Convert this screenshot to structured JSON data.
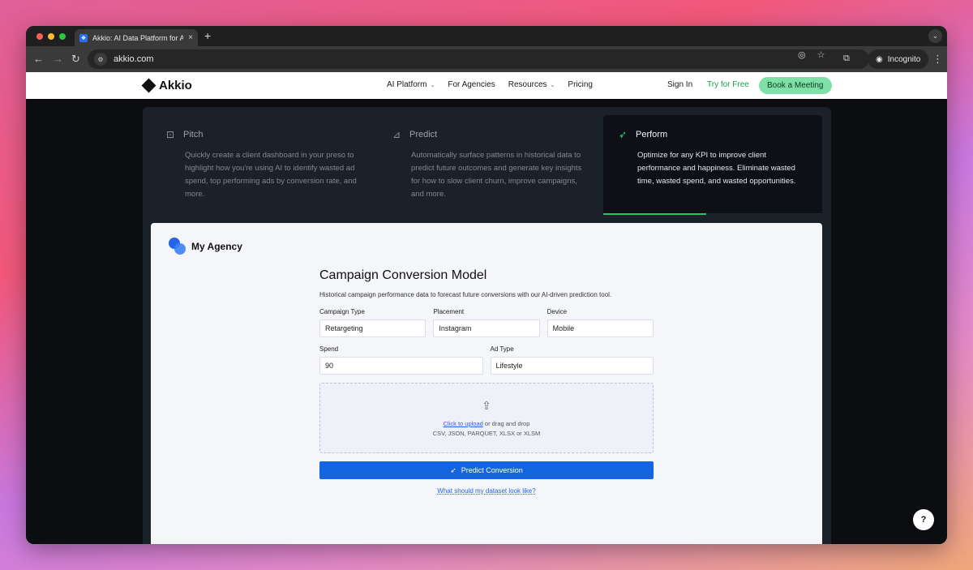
{
  "browser": {
    "tab_title": "Akkio: AI Data Platform for Ag",
    "tab_close": "×",
    "new_tab": "+",
    "url": "akkio.com",
    "incognito_label": "Incognito"
  },
  "nav": {
    "logo_text": "Akkio",
    "links": [
      {
        "label": "AI Platform",
        "has_dropdown": true
      },
      {
        "label": "For Agencies",
        "has_dropdown": false
      },
      {
        "label": "Resources",
        "has_dropdown": true
      },
      {
        "label": "Pricing",
        "has_dropdown": false
      }
    ],
    "sign_in": "Sign In",
    "try_free": "Try for Free",
    "book_meeting": "Book a Meeting"
  },
  "features": [
    {
      "title": "Pitch",
      "icon": "presentation-icon",
      "description": "Quickly create a client dashboard in your preso to highlight how you're using AI to identify wasted ad spend, top performing ads by conversion rate, and more.",
      "active": false
    },
    {
      "title": "Predict",
      "icon": "chart-icon",
      "description": "Automatically surface patterns in historical data to predict future outcomes and generate key insights for how to slow client churn, improve campaigns, and more.",
      "active": false
    },
    {
      "title": "Perform",
      "icon": "rocket-icon",
      "description": "Optimize for any KPI to improve client performance and happiness. Eliminate wasted time, wasted spend, and wasted opportunities.",
      "active": true,
      "progress_fraction": 0.47
    }
  ],
  "card": {
    "brand": "My Agency",
    "title": "Campaign Conversion Model",
    "subtitle": "Historical campaign performance data to forecast future conversions with our AI-driven prediction tool.",
    "fields": {
      "campaign_type": {
        "label": "Campaign Type",
        "value": "Retargeting"
      },
      "placement": {
        "label": "Placement",
        "value": "Instagram"
      },
      "device": {
        "label": "Device",
        "value": "Mobile"
      },
      "spend": {
        "label": "Spend",
        "value": "90"
      },
      "ad_type": {
        "label": "Ad Type",
        "value": "Lifestyle"
      }
    },
    "upload": {
      "link": "Click to upload",
      "rest": " or drag and drop",
      "formats": "CSV, JSON, PARQUET, XLSX or XLSM"
    },
    "predict_button": "Predict Conversion",
    "dataset_link": "What should my dataset look like?"
  },
  "help_label": "?",
  "colors": {
    "accent_green": "#22c55e",
    "primary_blue": "#1463e0",
    "book_meeting_bg": "#7fe0a7"
  }
}
